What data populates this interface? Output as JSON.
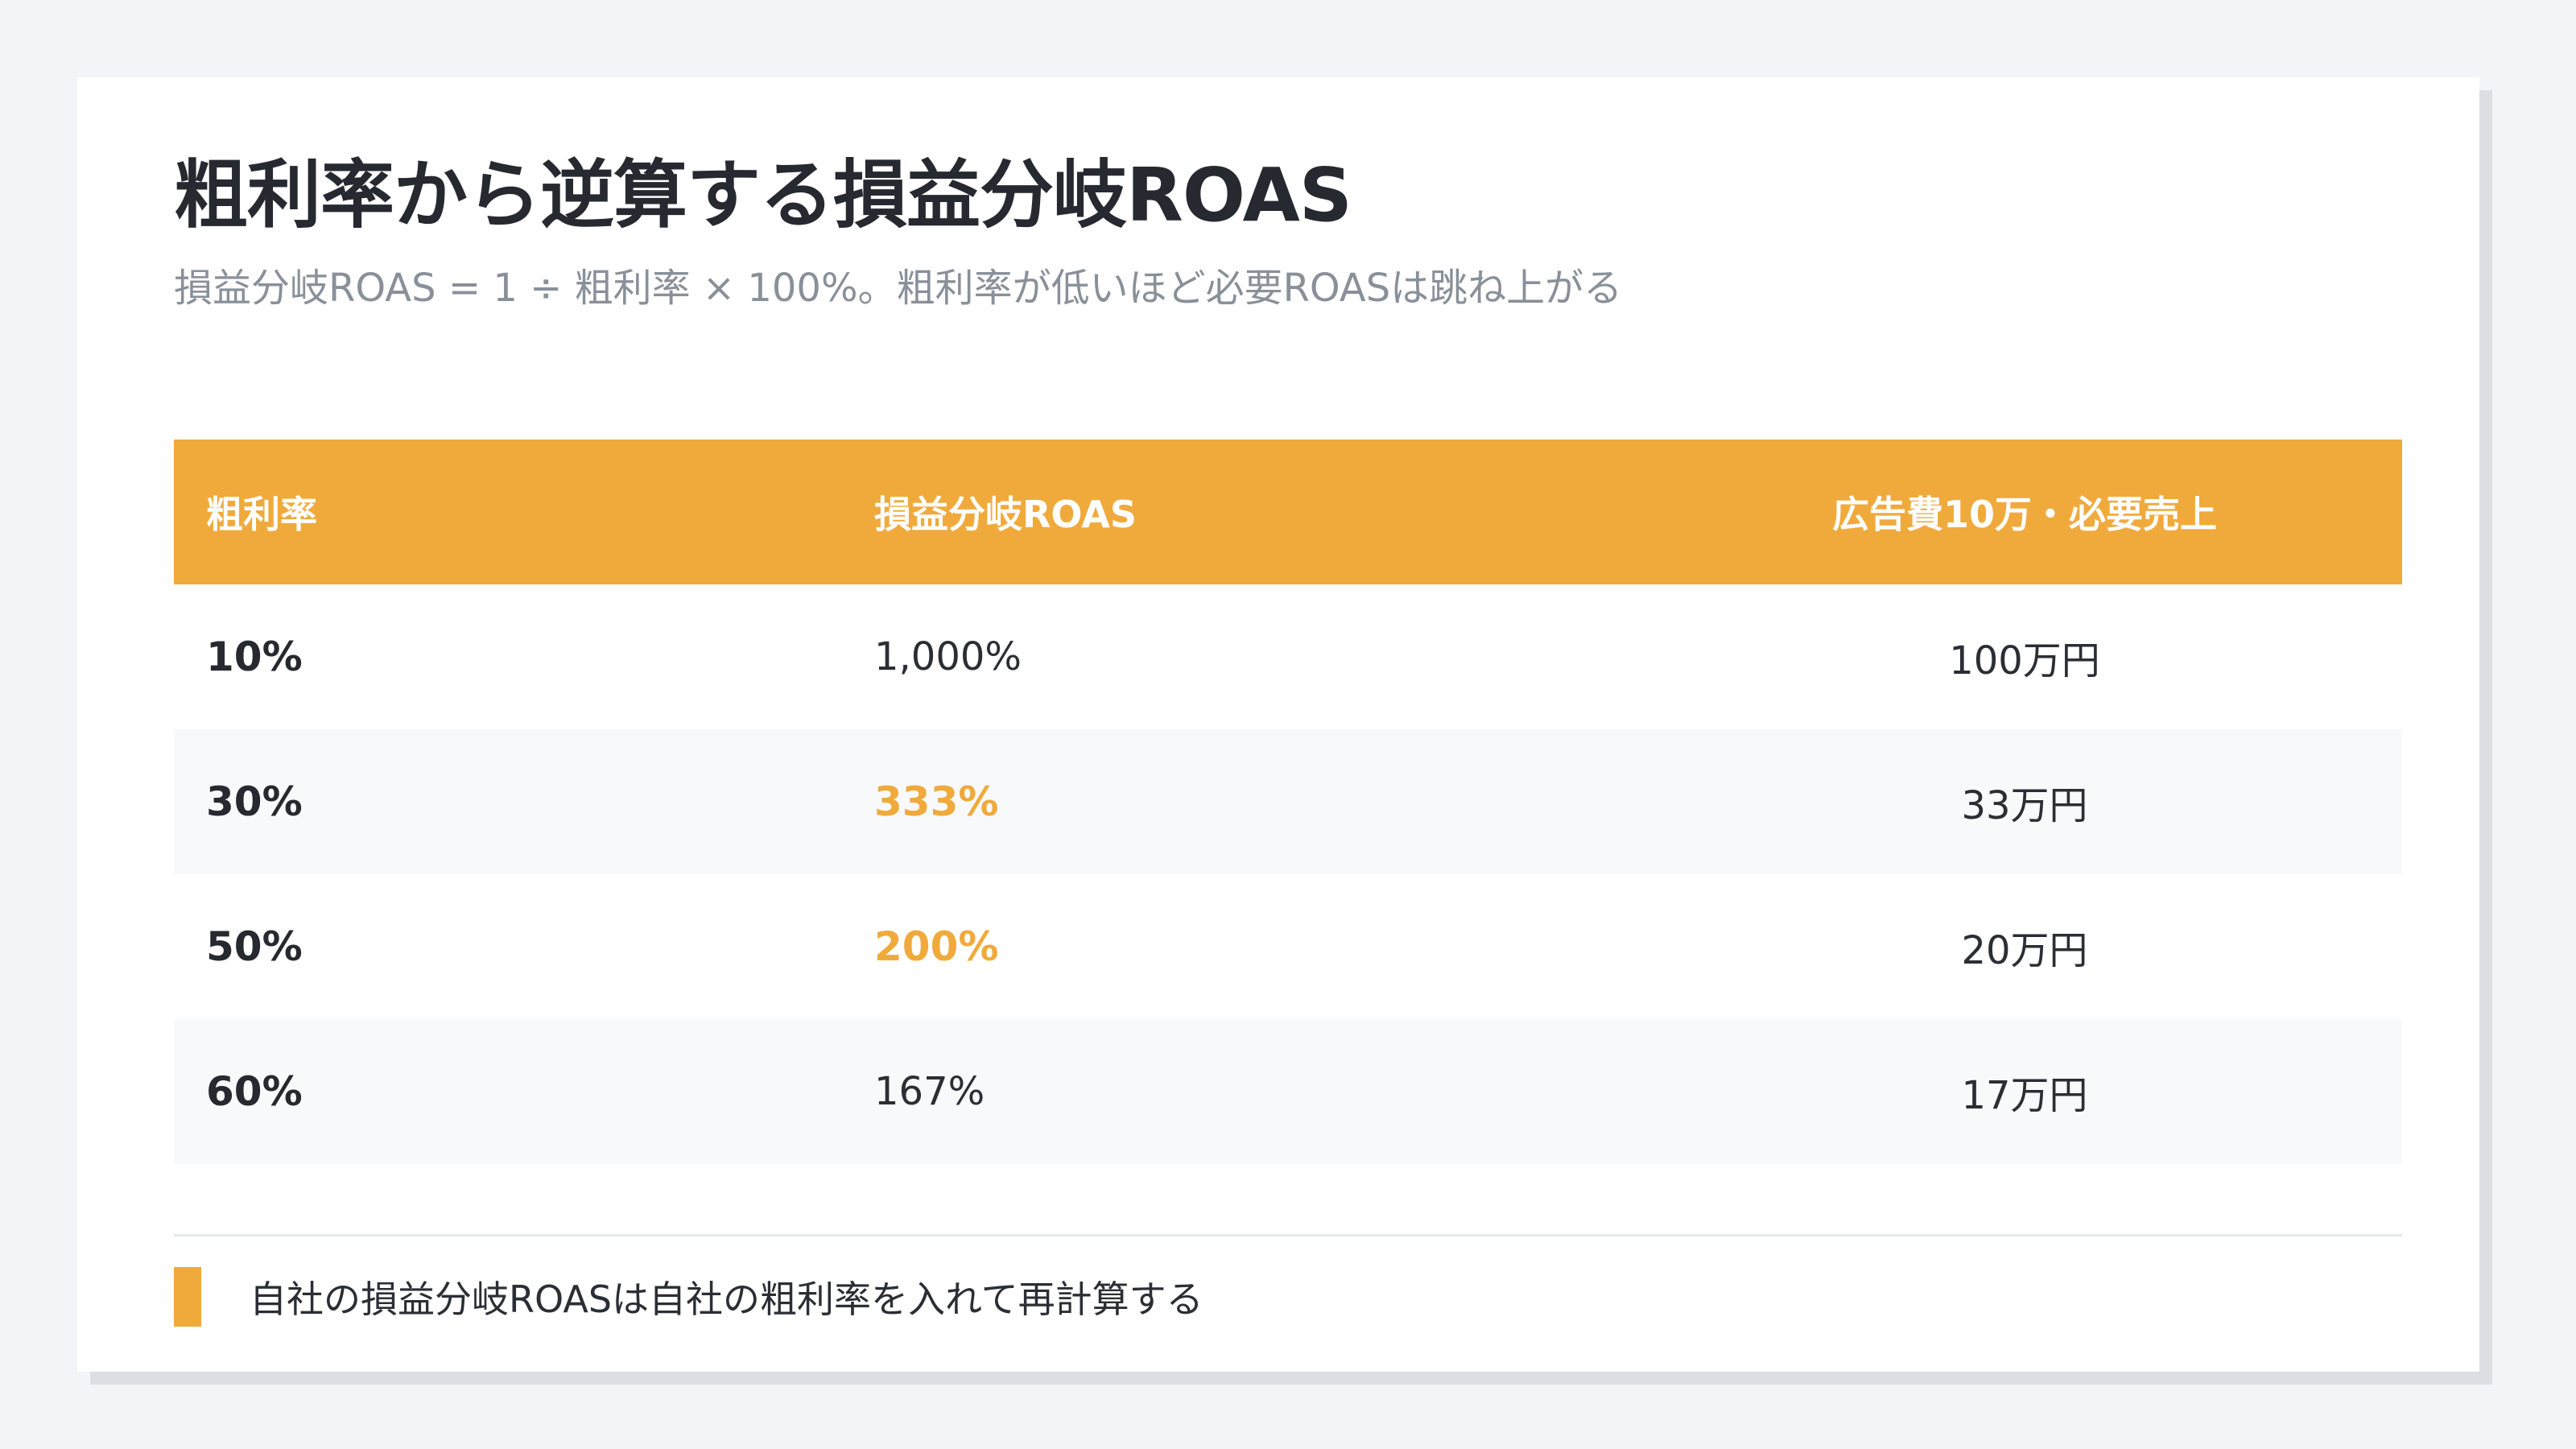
{
  "title": "粗利率から逆算する損益分岐ROAS",
  "subtitle": "損益分岐ROAS = 1 ÷ 粗利率 × 100%。粗利率が低いほど必要ROASは跳ね上がる",
  "table": {
    "headers": [
      "粗利率",
      "損益分岐ROAS",
      "広告費10万・必要売上"
    ],
    "rows": [
      {
        "margin": "10%",
        "roas": "1,000%",
        "sales": "100万円",
        "highlight": false
      },
      {
        "margin": "30%",
        "roas": "333%",
        "sales": "33万円",
        "highlight": true
      },
      {
        "margin": "50%",
        "roas": "200%",
        "sales": "20万円",
        "highlight": true
      },
      {
        "margin": "60%",
        "roas": "167%",
        "sales": "17万円",
        "highlight": false
      }
    ]
  },
  "note": "自社の損益分岐ROASは自社の粗利率を入れて再計算する",
  "colors": {
    "accent": "#f0aa3c",
    "background": "#f3f4f7",
    "card": "#ffffff",
    "text": "#26292f",
    "muted": "#8a9099"
  }
}
